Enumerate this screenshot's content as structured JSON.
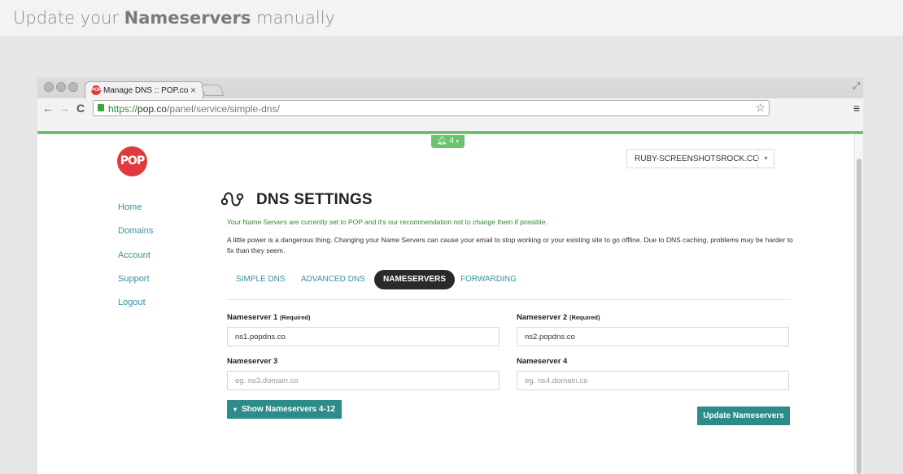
{
  "banner": {
    "title_pre": "Update your ",
    "title_bold": "Nameservers",
    "title_post": " manually"
  },
  "browser": {
    "tab_title": "Manage DNS :: POP.co",
    "tab_close": "×",
    "url_scheme": "https://",
    "url_host": "pop.co",
    "url_path": "/panel/service/simple-dns/",
    "back": "←",
    "forward": "→",
    "reload": "C",
    "star": "☆",
    "menu": "≡",
    "expand": "⤢"
  },
  "notification": {
    "icon": "bell-icon",
    "count": "4",
    "caret": "▾"
  },
  "logo": {
    "text": "POP",
    "color": "#e03a3e"
  },
  "domain_select": {
    "value": "RUBY-SCREENSHOTSROCK.CO",
    "caret": "▾"
  },
  "sidebar": {
    "items": [
      {
        "label": "Home"
      },
      {
        "label": "Domains"
      },
      {
        "label": "Account"
      },
      {
        "label": "Support"
      },
      {
        "label": "Logout"
      }
    ]
  },
  "page": {
    "title": "DNS SETTINGS",
    "note_green": "Your Name Servers are currently set to POP and it's our recommendation not to change them if possible.",
    "note_warn": "A little power is a dangerous thing. Changing your Name Servers can cause your email to stop working or your existing site to go offline. Due to DNS caching, problems may be harder to fix than they seem."
  },
  "tabs": [
    {
      "label": "SIMPLE DNS",
      "active": false
    },
    {
      "label": "ADVANCED DNS",
      "active": false
    },
    {
      "label": "NAMESERVERS",
      "active": true
    },
    {
      "label": "FORWARDING",
      "active": false
    }
  ],
  "form": {
    "ns1": {
      "label": "Nameserver 1",
      "suffix": "(Required)",
      "value": "ns1.popdns.co"
    },
    "ns2": {
      "label": "Nameserver 2",
      "suffix": "(Required)",
      "value": "ns2.popdns.co"
    },
    "ns3": {
      "label": "Nameserver 3",
      "placeholder": "eg. ns3.domain.co"
    },
    "ns4": {
      "label": "Nameserver 4",
      "placeholder": "eg. ns4.domain.co"
    },
    "show_more": "Show Nameservers 4-12",
    "show_more_icon": "chevron-down-icon",
    "submit": "Update Nameservers"
  },
  "colors": {
    "accent": "#3a8fa3",
    "button": "#2e8b8b",
    "green": "#6cc36e",
    "brand": "#e03a3e"
  }
}
